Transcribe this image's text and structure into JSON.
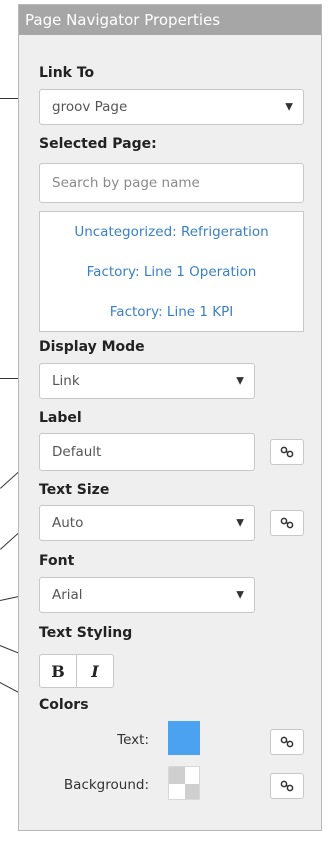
{
  "panel": {
    "title": "Page Navigator Properties"
  },
  "link_to": {
    "label": "Link To",
    "value": "groov Page"
  },
  "selected_page": {
    "label": "Selected Page:",
    "search_placeholder": "Search by page name",
    "pages": [
      "Uncategorized: Refrigeration",
      "Factory: Line 1 Operation",
      "Factory: Line 1 KPI"
    ]
  },
  "display_mode": {
    "label": "Display Mode",
    "value": "Link"
  },
  "label_field": {
    "label": "Label",
    "value": "Default"
  },
  "text_size": {
    "label": "Text Size",
    "value": "Auto"
  },
  "font": {
    "label": "Font",
    "value": "Arial"
  },
  "text_styling": {
    "label": "Text Styling",
    "bold": "B",
    "italic": "I"
  },
  "colors": {
    "label": "Colors",
    "text_label": "Text:",
    "text_color": "#4aa2f0",
    "background_label": "Background:",
    "background_color": "transparent"
  },
  "icons": {
    "caret": "▼",
    "link": "link-icon"
  }
}
